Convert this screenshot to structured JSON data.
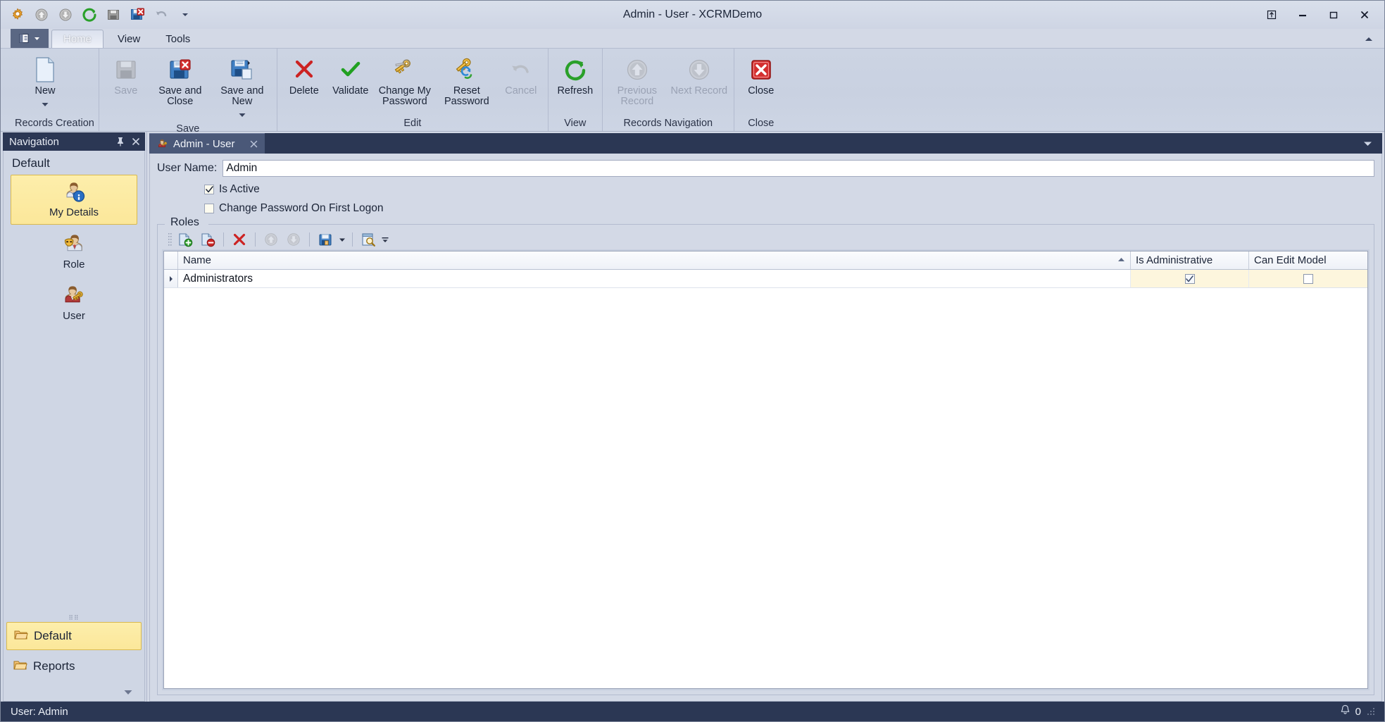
{
  "window": {
    "title": "Admin - User - XCRMDemo",
    "controls": [
      {
        "name": "restore-group-button",
        "glyph": "⤒"
      },
      {
        "name": "minimize-button",
        "glyph": "—"
      },
      {
        "name": "maximize-button",
        "glyph": "□"
      },
      {
        "name": "close-button",
        "glyph": "✕"
      }
    ]
  },
  "quick_access": {
    "items": [
      {
        "name": "application-settings-icon",
        "label": "Settings"
      },
      {
        "name": "previous-record-icon",
        "label": "Previous Record"
      },
      {
        "name": "next-record-icon",
        "label": "Next Record"
      },
      {
        "name": "refresh-icon",
        "label": "Refresh"
      },
      {
        "name": "save-icon",
        "label": "Save"
      },
      {
        "name": "save-and-close-icon",
        "label": "Save and Close"
      },
      {
        "name": "undo-icon",
        "label": "Undo"
      },
      {
        "name": "customize-quick-access-icon",
        "label": "Customize Quick Access Toolbar"
      }
    ]
  },
  "ribbon": {
    "app_menu_label": "",
    "tabs": [
      {
        "label": "Home",
        "active": true
      },
      {
        "label": "View",
        "active": false
      },
      {
        "label": "Tools",
        "active": false
      }
    ],
    "groups": [
      {
        "label": "Records Creation",
        "buttons": [
          {
            "label": "New",
            "icon": "new-document-icon",
            "disabled": false,
            "dropdown": true
          }
        ]
      },
      {
        "label": "Save",
        "buttons": [
          {
            "label": "Save",
            "icon": "save-icon",
            "disabled": true,
            "dropdown": false
          },
          {
            "label": "Save and Close",
            "icon": "save-and-close-icon",
            "disabled": false,
            "dropdown": false
          },
          {
            "label": "Save and New",
            "icon": "save-and-new-icon",
            "disabled": false,
            "dropdown": true
          }
        ]
      },
      {
        "label": "Edit",
        "buttons": [
          {
            "label": "Delete",
            "icon": "delete-icon",
            "disabled": false,
            "dropdown": false
          },
          {
            "label": "Validate",
            "icon": "validate-icon",
            "disabled": false,
            "dropdown": false
          },
          {
            "label": "Change My Password",
            "icon": "change-password-icon",
            "disabled": false,
            "dropdown": false
          },
          {
            "label": "Reset Password",
            "icon": "reset-password-icon",
            "disabled": false,
            "dropdown": false
          },
          {
            "label": "Cancel",
            "icon": "cancel-icon",
            "disabled": true,
            "dropdown": false
          }
        ]
      },
      {
        "label": "View",
        "buttons": [
          {
            "label": "Refresh",
            "icon": "refresh-icon",
            "disabled": false,
            "dropdown": false
          }
        ]
      },
      {
        "label": "Records Navigation",
        "buttons": [
          {
            "label": "Previous Record",
            "icon": "previous-record-icon",
            "disabled": true,
            "dropdown": false
          },
          {
            "label": "Next Record",
            "icon": "next-record-icon",
            "disabled": true,
            "dropdown": false
          }
        ]
      },
      {
        "label": "Close",
        "buttons": [
          {
            "label": "Close",
            "icon": "close-window-icon",
            "disabled": false,
            "dropdown": false
          }
        ]
      }
    ]
  },
  "navigation": {
    "title": "Navigation",
    "group_title": "Default",
    "items": [
      {
        "label": "My Details",
        "icon": "user-info-icon",
        "selected": true
      },
      {
        "label": "Role",
        "icon": "role-mask-icon",
        "selected": false
      },
      {
        "label": "User",
        "icon": "user-key-icon",
        "selected": false
      }
    ],
    "bars": [
      {
        "label": "Default",
        "icon": "folder-icon",
        "selected": true
      },
      {
        "label": "Reports",
        "icon": "folder-icon",
        "selected": false
      }
    ]
  },
  "document": {
    "tab": {
      "label": "Admin - User",
      "icon": "user-key-icon",
      "close_glyph": "✕"
    },
    "form": {
      "user_name_label": "User Name:",
      "user_name_value": "Admin",
      "user_name_placeholder": "",
      "checkboxes": [
        {
          "label": "Is Active",
          "checked": true
        },
        {
          "label": "Change Password On First Logon",
          "checked": false
        }
      ]
    },
    "roles": {
      "legend": "Roles",
      "toolbar": [
        {
          "name": "new-role-button",
          "icon": "add-record-icon",
          "disabled": false
        },
        {
          "name": "unlink-role-button",
          "icon": "remove-record-icon",
          "disabled": false
        },
        {
          "name": "delete-role-button",
          "icon": "delete-icon",
          "disabled": false
        },
        {
          "name": "move-up-button",
          "icon": "up-arrow-icon",
          "disabled": true
        },
        {
          "name": "move-down-button",
          "icon": "down-arrow-icon",
          "disabled": true
        },
        {
          "name": "export-button",
          "icon": "export-icon",
          "disabled": false,
          "dropdown": true
        },
        {
          "name": "find-button",
          "icon": "find-icon",
          "disabled": false
        }
      ],
      "columns": [
        {
          "label": "Name",
          "sorted": "asc"
        },
        {
          "label": "Is Administrative",
          "sorted": ""
        },
        {
          "label": "Can Edit Model",
          "sorted": ""
        }
      ],
      "rows": [
        {
          "name": "Administrators",
          "is_administrative": true,
          "can_edit_model": false,
          "selected": true
        }
      ]
    }
  },
  "statusbar": {
    "text": "User: Admin",
    "notification_count": "0",
    "notification_icon": "bell-icon"
  },
  "colors": {
    "accent_dark": "#2b3754",
    "ribbon_bg": "#ccd4e3",
    "panel_bg": "#cfd6e4",
    "selection_yellow": "#fbe79a",
    "row_highlight": "#fdf6dd",
    "grid_white": "#ffffff"
  }
}
